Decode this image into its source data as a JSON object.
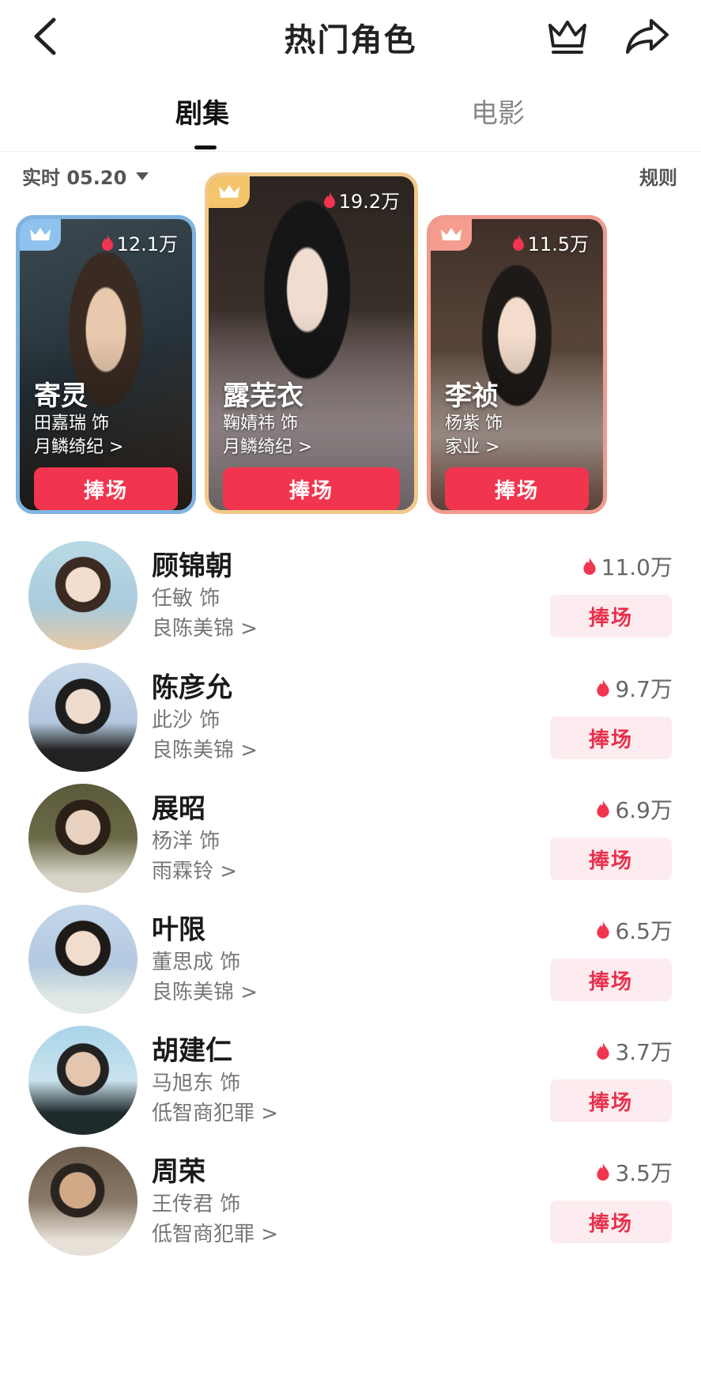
{
  "header": {
    "title": "热门角色"
  },
  "tabs": [
    {
      "label": "剧集",
      "active": true
    },
    {
      "label": "电影",
      "active": false
    }
  ],
  "filter": {
    "label": "实时 05.20",
    "rules": "规则"
  },
  "top3": [
    {
      "rank": 2,
      "name": "寄灵",
      "actor": "田嘉瑞 饰",
      "show": "月鳞绮纪 >",
      "heat": "12.1万",
      "cheer": "捧场",
      "frame_color": "#6fa8dc"
    },
    {
      "rank": 1,
      "name": "露芜衣",
      "actor": "鞠婧祎 饰",
      "show": "月鳞绮纪 >",
      "heat": "19.2万",
      "cheer": "捧场",
      "frame_color": "#f0c27b"
    },
    {
      "rank": 3,
      "name": "李祯",
      "actor": "杨紫 饰",
      "show": "家业 >",
      "heat": "11.5万",
      "cheer": "捧场",
      "frame_color": "#f08c80"
    }
  ],
  "list": [
    {
      "name": "顾锦朝",
      "actor": "任敏 饰",
      "show": "良陈美锦 >",
      "heat": "11.0万",
      "cheer": "捧场"
    },
    {
      "name": "陈彦允",
      "actor": "此沙 饰",
      "show": "良陈美锦 >",
      "heat": "9.7万",
      "cheer": "捧场"
    },
    {
      "name": "展昭",
      "actor": "杨洋 饰",
      "show": "雨霖铃 >",
      "heat": "6.9万",
      "cheer": "捧场"
    },
    {
      "name": "叶限",
      "actor": "董思成 饰",
      "show": "良陈美锦 >",
      "heat": "6.5万",
      "cheer": "捧场"
    },
    {
      "name": "胡建仁",
      "actor": "马旭东 饰",
      "show": "低智商犯罪 >",
      "heat": "3.7万",
      "cheer": "捧场"
    },
    {
      "name": "周荣",
      "actor": "王传君 饰",
      "show": "低智商犯罪 >",
      "heat": "3.5万",
      "cheer": "捧场"
    }
  ],
  "colors": {
    "accent": "#f2354f",
    "cheer_light_bg": "#fdecef"
  }
}
